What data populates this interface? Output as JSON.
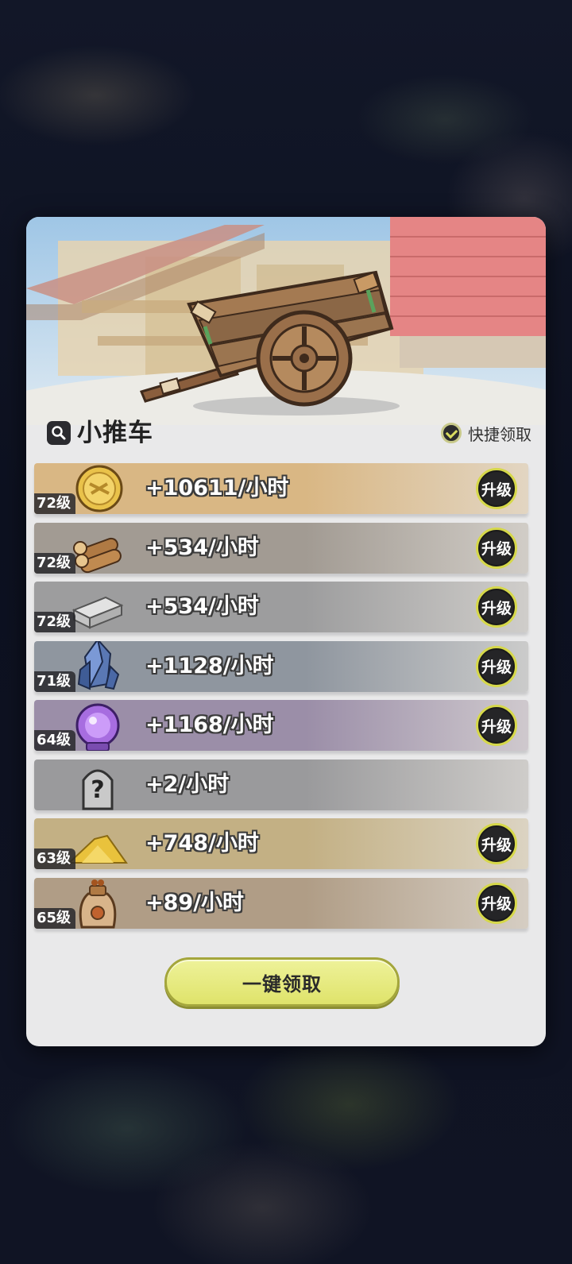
{
  "panel": {
    "title": "小推车",
    "quick_claim_label": "快捷领取",
    "claim_all_label": "一键领取"
  },
  "colors": {
    "accent": "#d6d84a",
    "button_fill": "#e3e67a",
    "dialog_bg": "#e9e9ea"
  },
  "resources": [
    {
      "name": "gold-coin",
      "level": "72级",
      "rate": "+10611/小时",
      "upgrade_label": "升级",
      "has_upgrade": true,
      "color": "#d9b784"
    },
    {
      "name": "wood",
      "level": "72级",
      "rate": "+534/小时",
      "upgrade_label": "升级",
      "has_upgrade": true,
      "color": "#a29b93"
    },
    {
      "name": "stone",
      "level": "72级",
      "rate": "+534/小时",
      "upgrade_label": "升级",
      "has_upgrade": true,
      "color": "#9d9d9e"
    },
    {
      "name": "crystal",
      "level": "71级",
      "rate": "+1128/小时",
      "upgrade_label": "升级",
      "has_upgrade": true,
      "color": "#8f969f"
    },
    {
      "name": "orb",
      "level": "64级",
      "rate": "+1168/小时",
      "upgrade_label": "升级",
      "has_upgrade": true,
      "color": "#9b8ea8"
    },
    {
      "name": "mystery",
      "level": "",
      "rate": "+2/小时",
      "upgrade_label": "",
      "has_upgrade": false,
      "color": "#9a9a9c"
    },
    {
      "name": "sand",
      "level": "63级",
      "rate": "+748/小时",
      "upgrade_label": "升级",
      "has_upgrade": true,
      "color": "#c3b084"
    },
    {
      "name": "grain-sack",
      "level": "65级",
      "rate": "+89/小时",
      "upgrade_label": "升级",
      "has_upgrade": true,
      "color": "#b09d86"
    }
  ]
}
